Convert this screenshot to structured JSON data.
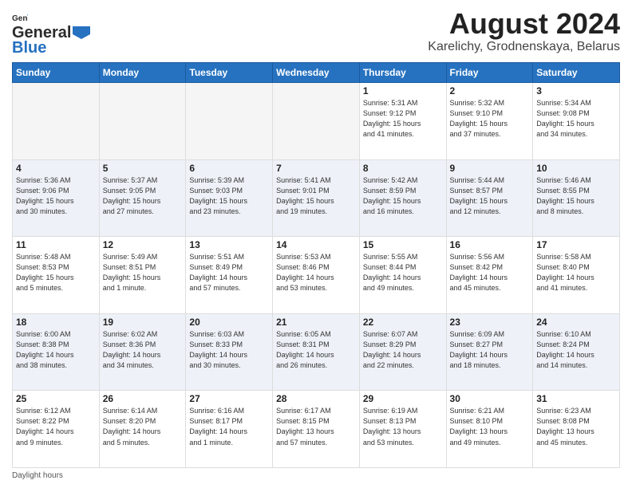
{
  "header": {
    "logo_line1": "General",
    "logo_line2": "Blue",
    "title": "August 2024",
    "subtitle": "Karelichy, Grodnenskaya, Belarus"
  },
  "weekdays": [
    "Sunday",
    "Monday",
    "Tuesday",
    "Wednesday",
    "Thursday",
    "Friday",
    "Saturday"
  ],
  "weeks": [
    [
      {
        "day": "",
        "info": ""
      },
      {
        "day": "",
        "info": ""
      },
      {
        "day": "",
        "info": ""
      },
      {
        "day": "",
        "info": ""
      },
      {
        "day": "1",
        "info": "Sunrise: 5:31 AM\nSunset: 9:12 PM\nDaylight: 15 hours\nand 41 minutes."
      },
      {
        "day": "2",
        "info": "Sunrise: 5:32 AM\nSunset: 9:10 PM\nDaylight: 15 hours\nand 37 minutes."
      },
      {
        "day": "3",
        "info": "Sunrise: 5:34 AM\nSunset: 9:08 PM\nDaylight: 15 hours\nand 34 minutes."
      }
    ],
    [
      {
        "day": "4",
        "info": "Sunrise: 5:36 AM\nSunset: 9:06 PM\nDaylight: 15 hours\nand 30 minutes."
      },
      {
        "day": "5",
        "info": "Sunrise: 5:37 AM\nSunset: 9:05 PM\nDaylight: 15 hours\nand 27 minutes."
      },
      {
        "day": "6",
        "info": "Sunrise: 5:39 AM\nSunset: 9:03 PM\nDaylight: 15 hours\nand 23 minutes."
      },
      {
        "day": "7",
        "info": "Sunrise: 5:41 AM\nSunset: 9:01 PM\nDaylight: 15 hours\nand 19 minutes."
      },
      {
        "day": "8",
        "info": "Sunrise: 5:42 AM\nSunset: 8:59 PM\nDaylight: 15 hours\nand 16 minutes."
      },
      {
        "day": "9",
        "info": "Sunrise: 5:44 AM\nSunset: 8:57 PM\nDaylight: 15 hours\nand 12 minutes."
      },
      {
        "day": "10",
        "info": "Sunrise: 5:46 AM\nSunset: 8:55 PM\nDaylight: 15 hours\nand 8 minutes."
      }
    ],
    [
      {
        "day": "11",
        "info": "Sunrise: 5:48 AM\nSunset: 8:53 PM\nDaylight: 15 hours\nand 5 minutes."
      },
      {
        "day": "12",
        "info": "Sunrise: 5:49 AM\nSunset: 8:51 PM\nDaylight: 15 hours\nand 1 minute."
      },
      {
        "day": "13",
        "info": "Sunrise: 5:51 AM\nSunset: 8:49 PM\nDaylight: 14 hours\nand 57 minutes."
      },
      {
        "day": "14",
        "info": "Sunrise: 5:53 AM\nSunset: 8:46 PM\nDaylight: 14 hours\nand 53 minutes."
      },
      {
        "day": "15",
        "info": "Sunrise: 5:55 AM\nSunset: 8:44 PM\nDaylight: 14 hours\nand 49 minutes."
      },
      {
        "day": "16",
        "info": "Sunrise: 5:56 AM\nSunset: 8:42 PM\nDaylight: 14 hours\nand 45 minutes."
      },
      {
        "day": "17",
        "info": "Sunrise: 5:58 AM\nSunset: 8:40 PM\nDaylight: 14 hours\nand 41 minutes."
      }
    ],
    [
      {
        "day": "18",
        "info": "Sunrise: 6:00 AM\nSunset: 8:38 PM\nDaylight: 14 hours\nand 38 minutes."
      },
      {
        "day": "19",
        "info": "Sunrise: 6:02 AM\nSunset: 8:36 PM\nDaylight: 14 hours\nand 34 minutes."
      },
      {
        "day": "20",
        "info": "Sunrise: 6:03 AM\nSunset: 8:33 PM\nDaylight: 14 hours\nand 30 minutes."
      },
      {
        "day": "21",
        "info": "Sunrise: 6:05 AM\nSunset: 8:31 PM\nDaylight: 14 hours\nand 26 minutes."
      },
      {
        "day": "22",
        "info": "Sunrise: 6:07 AM\nSunset: 8:29 PM\nDaylight: 14 hours\nand 22 minutes."
      },
      {
        "day": "23",
        "info": "Sunrise: 6:09 AM\nSunset: 8:27 PM\nDaylight: 14 hours\nand 18 minutes."
      },
      {
        "day": "24",
        "info": "Sunrise: 6:10 AM\nSunset: 8:24 PM\nDaylight: 14 hours\nand 14 minutes."
      }
    ],
    [
      {
        "day": "25",
        "info": "Sunrise: 6:12 AM\nSunset: 8:22 PM\nDaylight: 14 hours\nand 9 minutes."
      },
      {
        "day": "26",
        "info": "Sunrise: 6:14 AM\nSunset: 8:20 PM\nDaylight: 14 hours\nand 5 minutes."
      },
      {
        "day": "27",
        "info": "Sunrise: 6:16 AM\nSunset: 8:17 PM\nDaylight: 14 hours\nand 1 minute."
      },
      {
        "day": "28",
        "info": "Sunrise: 6:17 AM\nSunset: 8:15 PM\nDaylight: 13 hours\nand 57 minutes."
      },
      {
        "day": "29",
        "info": "Sunrise: 6:19 AM\nSunset: 8:13 PM\nDaylight: 13 hours\nand 53 minutes."
      },
      {
        "day": "30",
        "info": "Sunrise: 6:21 AM\nSunset: 8:10 PM\nDaylight: 13 hours\nand 49 minutes."
      },
      {
        "day": "31",
        "info": "Sunrise: 6:23 AM\nSunset: 8:08 PM\nDaylight: 13 hours\nand 45 minutes."
      }
    ]
  ],
  "footer": {
    "text": "Daylight hours"
  }
}
